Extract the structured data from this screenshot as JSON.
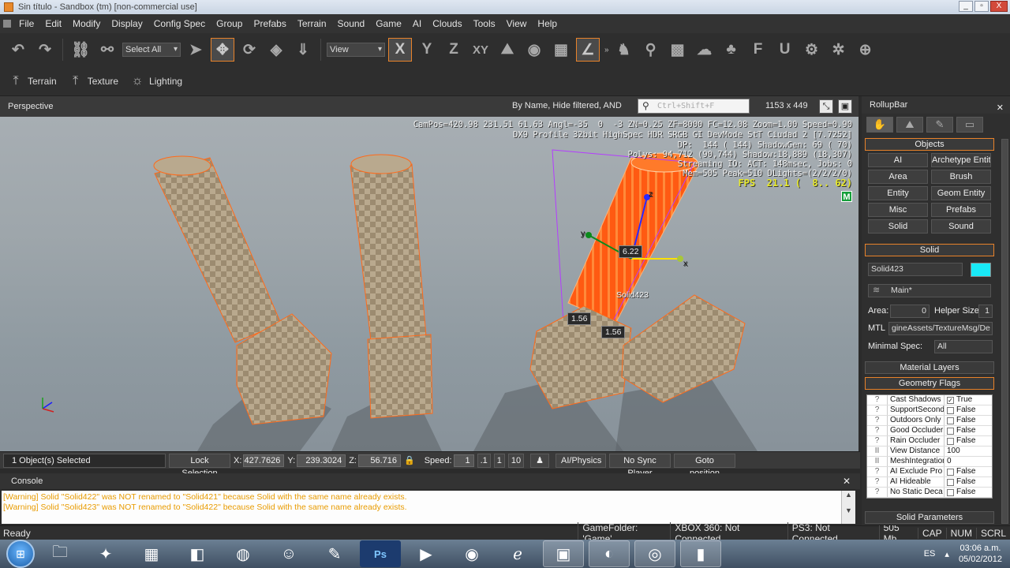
{
  "window": {
    "title": "Sin título - Sandbox (tm) [non-commercial use]",
    "minimize": "_",
    "maximize": "▫",
    "close": "X"
  },
  "menu": [
    "File",
    "Edit",
    "Modify",
    "Display",
    "Config Spec",
    "Group",
    "Prefabs",
    "Terrain",
    "Sound",
    "Game",
    "AI",
    "Clouds",
    "Tools",
    "View",
    "Help"
  ],
  "toolbar": {
    "select_filter": "Select All",
    "coord_system": "View",
    "axis_x": "X",
    "axis_y": "Y",
    "axis_z": "Z",
    "axis_xy": "XY",
    "overflow": "»"
  },
  "toolbar2": [
    {
      "label": "Terrain",
      "icon": "terrain-icon"
    },
    {
      "label": "Texture",
      "icon": "texture-icon"
    },
    {
      "label": "Lighting",
      "icon": "lighting-icon"
    }
  ],
  "viewport": {
    "name": "Perspective",
    "filter": "By Name, Hide filtered, AND",
    "search_placeholder": "Ctrl+Shift+F",
    "resolution": "1153 x 449",
    "hud_lines": [
      "CamPos=420.98 231.51 61.63 Angl=-35  0  -3 ZN=0.25 ZF=8000 FC=12.08 Zoom=1.00 Speed=0.90",
      "DX9 Profile 32bit HighSpec HDR SRGB GI DevMode StT Ciudad 2 [7.7252]",
      "DP:  144 ( 144) ShadowGen: 69 ( 70)",
      "Polys: 94,712 (90,744) Shadow:18,889 (18,307)",
      "Streaming IO: ACT: 148msec, Jobs: 0",
      "Mem=505 Peak=510 DLights=(2/2/2/0)"
    ],
    "fps": "FPS  21.1 (  8.. 62)",
    "m_badge": "M",
    "dim_top": "6.22",
    "dim_left": "1.56",
    "dim_right": "1.56",
    "selected_label": "Solid423",
    "gizmo_x": "x",
    "gizmo_y": "y",
    "gizmo_z": "z"
  },
  "vp_status": {
    "selected": "1 Object(s) Selected",
    "lock": "Lock Selection",
    "x_label": "X:",
    "x_val": "427.7626",
    "y_label": "Y:",
    "y_val": "239.3024",
    "z_label": "Z:",
    "z_val": "56.716",
    "speed_label": "Speed:",
    "speed_val": "1",
    "speed_presets": [
      ".1",
      "1",
      "10"
    ],
    "ai_physics": "AI/Physics",
    "no_sync": "No Sync Player",
    "goto": "Goto position"
  },
  "console": {
    "title": "Console",
    "lines": [
      "[Warning] Solid \"Solid422\" was NOT renamed to \"Solid421\" because Solid with the same name already exists.",
      "[Warning] Solid \"Solid423\" was NOT renamed to \"Solid422\" because Solid with the same name already exists."
    ]
  },
  "statusbar": {
    "ready": "Ready",
    "game_folder": "GameFolder: 'Game'",
    "xbox": "XBOX 360: Not Connected",
    "ps3": "PS3: Not Connected",
    "mem": "505 Mb",
    "cap": "CAP",
    "num": "NUM",
    "scrl": "SCRL"
  },
  "rollup": {
    "title": "RollupBar",
    "objects_hdr": "Objects",
    "object_buttons": [
      "AI",
      "Archetype Entity",
      "Area",
      "Brush",
      "Entity",
      "Geom Entity",
      "Misc",
      "Prefabs",
      "Solid",
      "Sound"
    ],
    "solid_hdr": "Solid",
    "solid_name": "Solid423",
    "layer": "Main*",
    "area_label": "Area:",
    "area_val": "0",
    "helper_label": "Helper Size:",
    "helper_val": "1",
    "mtl_label": "MTL",
    "mtl_val": "gineAssets/TextureMsg/De",
    "minspec_label": "Minimal Spec:",
    "minspec_val": "All",
    "material_layers_hdr": "Material Layers",
    "geometry_flags_hdr": "Geometry Flags",
    "geo_flags": [
      {
        "q": "?",
        "name": "Cast Shadows",
        "value": "True",
        "checked": true
      },
      {
        "q": "?",
        "name": "SupportSecond",
        "value": "False",
        "checked": false
      },
      {
        "q": "?",
        "name": "Outdoors Only",
        "value": "False",
        "checked": false
      },
      {
        "q": "?",
        "name": "Good Occluder",
        "value": "False",
        "checked": false
      },
      {
        "q": "?",
        "name": "Rain Occluder",
        "value": "False",
        "checked": false
      },
      {
        "q": "II",
        "name": "View Distance",
        "value": "100",
        "checked": null
      },
      {
        "q": "II",
        "name": "MeshIntegration",
        "value": "0",
        "checked": null
      },
      {
        "q": "?",
        "name": "AI Exclude Pro",
        "value": "False",
        "checked": false
      },
      {
        "q": "?",
        "name": "AI Hideable",
        "value": "False",
        "checked": false
      },
      {
        "q": "?",
        "name": "No Static Deca",
        "value": "False",
        "checked": false
      }
    ],
    "solid_params_hdr": "Solid Parameters"
  },
  "taskbar": {
    "lang": "ES",
    "time": "03:06 a.m.",
    "date": "05/02/2012",
    "ps_label": "Ps"
  },
  "colors": {
    "accent": "#e8822a",
    "selection": "#ff6a1a",
    "swatch": "#19e9f6",
    "warning": "#e89b00"
  }
}
